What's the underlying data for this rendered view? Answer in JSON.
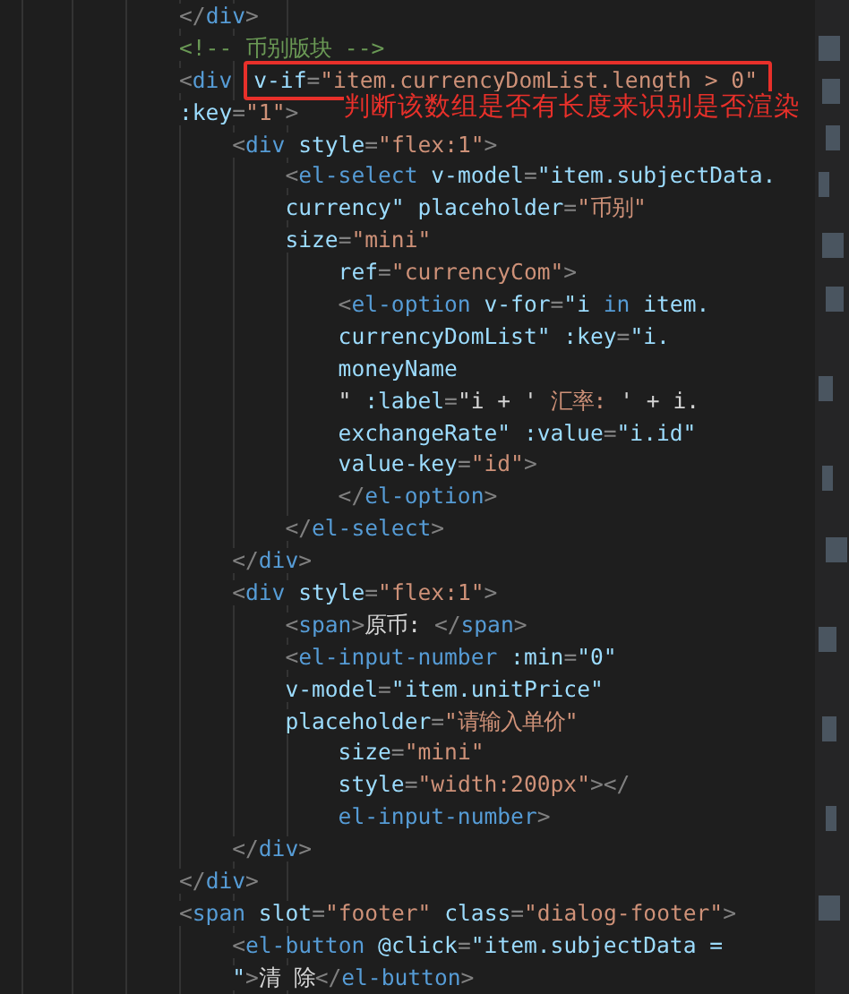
{
  "editor": {
    "lines": [
      {
        "tokens": [
          {
            "kind": "punct",
            "text": "</"
          },
          {
            "kind": "tag",
            "text": "div"
          },
          {
            "kind": "punct",
            "text": ">"
          }
        ]
      },
      {
        "tokens": [
          {
            "kind": "comment",
            "text": "<!-- 币别版块 -->"
          }
        ]
      },
      {
        "tokens": [
          {
            "kind": "punct",
            "text": "<"
          },
          {
            "kind": "tag",
            "text": "div"
          },
          {
            "kind": "attr",
            "text": "v-if",
            "boxed": true
          },
          {
            "kind": "punct",
            "text": "=",
            "boxed": true
          },
          {
            "kind": "string",
            "text": "\"item.currencyDomList.length > 0\"",
            "boxed": true
          }
        ]
      },
      {
        "tokens": [
          {
            "kind": "attr",
            "text": ":key"
          },
          {
            "kind": "punct",
            "text": "="
          },
          {
            "kind": "string",
            "text": "\"1\""
          },
          {
            "kind": "punct",
            "text": ">"
          }
        ],
        "children": [
          {
            "tokens": [
              {
                "kind": "punct",
                "text": "<"
              },
              {
                "kind": "tag",
                "text": "div"
              },
              {
                "kind": "attr",
                "text": " style"
              },
              {
                "kind": "punct",
                "text": "="
              },
              {
                "kind": "string",
                "text": "\"flex:1\""
              },
              {
                "kind": "punct",
                "text": ">"
              }
            ],
            "children": [
              {
                "tokens": [
                  {
                    "kind": "punct",
                    "text": "<"
                  },
                  {
                    "kind": "tag",
                    "text": "el-select"
                  },
                  {
                    "kind": "attr",
                    "text": " v-model"
                  },
                  {
                    "kind": "punct",
                    "text": "="
                  },
                  {
                    "kind": "attr",
                    "text": "\"item.subjectData."
                  }
                ]
              },
              {
                "tokens": [
                  {
                    "kind": "attr",
                    "text": "currency\" placeholder"
                  },
                  {
                    "kind": "punct",
                    "text": "="
                  },
                  {
                    "kind": "string",
                    "text": "\"币别\""
                  }
                ]
              },
              {
                "tokens": [
                  {
                    "kind": "attr",
                    "text": "size"
                  },
                  {
                    "kind": "punct",
                    "text": "="
                  },
                  {
                    "kind": "string",
                    "text": "\"mini\""
                  }
                ],
                "children": [
                  {
                    "tokens": [
                      {
                        "kind": "attr",
                        "text": "ref"
                      },
                      {
                        "kind": "punct",
                        "text": "="
                      },
                      {
                        "kind": "string",
                        "text": "\"currencyCom\""
                      },
                      {
                        "kind": "punct",
                        "text": ">"
                      }
                    ]
                  },
                  {
                    "tokens": [
                      {
                        "kind": "punct",
                        "text": "<"
                      },
                      {
                        "kind": "tag",
                        "text": "el-option"
                      },
                      {
                        "kind": "attr",
                        "text": " v-for"
                      },
                      {
                        "kind": "punct",
                        "text": "="
                      },
                      {
                        "kind": "attr",
                        "text": "\"i "
                      },
                      {
                        "kind": "tag",
                        "text": "in"
                      },
                      {
                        "kind": "attr",
                        "text": " item."
                      }
                    ]
                  },
                  {
                    "tokens": [
                      {
                        "kind": "attr",
                        "text": "currencyDomList\" :key"
                      },
                      {
                        "kind": "punct",
                        "text": "="
                      },
                      {
                        "kind": "attr",
                        "text": "\"i."
                      }
                    ]
                  },
                  {
                    "tokens": [
                      {
                        "kind": "attr",
                        "text": "moneyName"
                      }
                    ]
                  },
                  {
                    "tokens": [
                      {
                        "kind": "plain",
                        "text": "\" "
                      },
                      {
                        "kind": "attr",
                        "text": ":label"
                      },
                      {
                        "kind": "punct",
                        "text": "="
                      },
                      {
                        "kind": "plain",
                        "text": "\"i + ' "
                      },
                      {
                        "kind": "string",
                        "text": "汇率: "
                      },
                      {
                        "kind": "plain",
                        "text": "' + i."
                      }
                    ]
                  },
                  {
                    "tokens": [
                      {
                        "kind": "attr",
                        "text": "exchangeRate\" :value"
                      },
                      {
                        "kind": "punct",
                        "text": "="
                      },
                      {
                        "kind": "attr",
                        "text": "\"i.id\""
                      }
                    ]
                  },
                  {
                    "tokens": [
                      {
                        "kind": "attr",
                        "text": "value-key"
                      },
                      {
                        "kind": "punct",
                        "text": "="
                      },
                      {
                        "kind": "string",
                        "text": "\"id\""
                      },
                      {
                        "kind": "punct",
                        "text": ">"
                      }
                    ]
                  },
                  {
                    "tokens": [
                      {
                        "kind": "punct",
                        "text": "</"
                      },
                      {
                        "kind": "tag",
                        "text": "el-option"
                      },
                      {
                        "kind": "punct",
                        "text": ">"
                      }
                    ]
                  }
                ]
              },
              {
                "tokens": [
                  {
                    "kind": "punct",
                    "text": "</"
                  },
                  {
                    "kind": "tag",
                    "text": "el-select"
                  },
                  {
                    "kind": "punct",
                    "text": ">"
                  }
                ]
              }
            ]
          },
          {
            "tokens": [
              {
                "kind": "punct",
                "text": "</"
              },
              {
                "kind": "tag",
                "text": "div"
              },
              {
                "kind": "punct",
                "text": ">"
              }
            ]
          },
          {
            "tokens": [
              {
                "kind": "punct",
                "text": "<"
              },
              {
                "kind": "tag",
                "text": "div"
              },
              {
                "kind": "attr",
                "text": " style"
              },
              {
                "kind": "punct",
                "text": "="
              },
              {
                "kind": "string",
                "text": "\"flex:1\""
              },
              {
                "kind": "punct",
                "text": ">"
              }
            ],
            "children": [
              {
                "tokens": [
                  {
                    "kind": "punct",
                    "text": "<"
                  },
                  {
                    "kind": "tag",
                    "text": "span"
                  },
                  {
                    "kind": "punct",
                    "text": ">"
                  },
                  {
                    "kind": "plain",
                    "text": "原币: "
                  },
                  {
                    "kind": "punct",
                    "text": "</"
                  },
                  {
                    "kind": "tag",
                    "text": "span"
                  },
                  {
                    "kind": "punct",
                    "text": ">"
                  }
                ]
              },
              {
                "tokens": [
                  {
                    "kind": "punct",
                    "text": "<"
                  },
                  {
                    "kind": "tag",
                    "text": "el-input-number"
                  },
                  {
                    "kind": "attr",
                    "text": " :min"
                  },
                  {
                    "kind": "punct",
                    "text": "="
                  },
                  {
                    "kind": "attr",
                    "text": "\"0\""
                  }
                ]
              },
              {
                "tokens": [
                  {
                    "kind": "attr",
                    "text": "v-model"
                  },
                  {
                    "kind": "punct",
                    "text": "="
                  },
                  {
                    "kind": "attr",
                    "text": "\"item.unitPrice\""
                  }
                ]
              },
              {
                "tokens": [
                  {
                    "kind": "attr",
                    "text": "placeholder"
                  },
                  {
                    "kind": "punct",
                    "text": "="
                  },
                  {
                    "kind": "string",
                    "text": "\"请输入单价\""
                  }
                ],
                "children": [
                  {
                    "tokens": [
                      {
                        "kind": "attr",
                        "text": "size"
                      },
                      {
                        "kind": "punct",
                        "text": "="
                      },
                      {
                        "kind": "string",
                        "text": "\"mini\""
                      }
                    ]
                  },
                  {
                    "tokens": [
                      {
                        "kind": "attr",
                        "text": "style"
                      },
                      {
                        "kind": "punct",
                        "text": "="
                      },
                      {
                        "kind": "string",
                        "text": "\"width:200px\""
                      },
                      {
                        "kind": "punct",
                        "text": "></"
                      }
                    ]
                  },
                  {
                    "tokens": [
                      {
                        "kind": "tag",
                        "text": "el-input-number"
                      },
                      {
                        "kind": "punct",
                        "text": ">"
                      }
                    ]
                  }
                ]
              }
            ]
          },
          {
            "tokens": [
              {
                "kind": "punct",
                "text": "</"
              },
              {
                "kind": "tag",
                "text": "div"
              },
              {
                "kind": "punct",
                "text": ">"
              }
            ]
          }
        ]
      },
      {
        "tokens": [
          {
            "kind": "punct",
            "text": "</"
          },
          {
            "kind": "tag",
            "text": "div"
          },
          {
            "kind": "punct",
            "text": ">"
          }
        ]
      },
      {
        "tokens": [
          {
            "kind": "punct",
            "text": "<"
          },
          {
            "kind": "tag",
            "text": "span"
          },
          {
            "kind": "attr",
            "text": " slot"
          },
          {
            "kind": "punct",
            "text": "="
          },
          {
            "kind": "string",
            "text": "\"footer\""
          },
          {
            "kind": "attr",
            "text": " class"
          },
          {
            "kind": "punct",
            "text": "="
          },
          {
            "kind": "string",
            "text": "\"dialog-footer\""
          },
          {
            "kind": "punct",
            "text": ">"
          }
        ],
        "children": [
          {
            "tokens": [
              {
                "kind": "punct",
                "text": "<"
              },
              {
                "kind": "tag",
                "text": "el-button"
              },
              {
                "kind": "attr",
                "text": " @click"
              },
              {
                "kind": "punct",
                "text": "="
              },
              {
                "kind": "attr",
                "text": "\"item.subjectData ="
              }
            ]
          },
          {
            "tokens": [
              {
                "kind": "attr",
                "text": "\""
              },
              {
                "kind": "punct",
                "text": ">"
              },
              {
                "kind": "plain",
                "text": "清 除"
              },
              {
                "kind": "punct",
                "text": "</"
              },
              {
                "kind": "tag",
                "text": "el-button"
              },
              {
                "kind": "punct",
                "text": ">"
              }
            ]
          }
        ]
      }
    ]
  },
  "annotation": {
    "text": "判断该数组是否有长度来识别是否渲染"
  }
}
